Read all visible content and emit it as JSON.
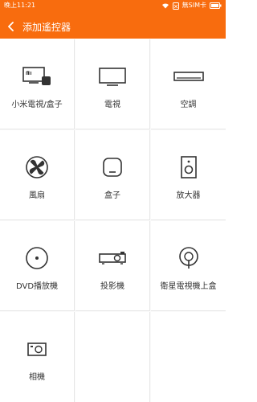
{
  "status_bar": {
    "time": "晚上11:21",
    "sim": "無SIM卡"
  },
  "header": {
    "title": "添加遙控器"
  },
  "devices": [
    {
      "label": "小米電視/盒子",
      "icon": "mi-tv-box-icon"
    },
    {
      "label": "電視",
      "icon": "tv-icon"
    },
    {
      "label": "空調",
      "icon": "air-conditioner-icon"
    },
    {
      "label": "風扇",
      "icon": "fan-icon"
    },
    {
      "label": "盒子",
      "icon": "box-icon"
    },
    {
      "label": "放大器",
      "icon": "speaker-icon"
    },
    {
      "label": "DVD播放機",
      "icon": "dvd-icon"
    },
    {
      "label": "投影機",
      "icon": "projector-icon"
    },
    {
      "label": "衛星電視機上盒",
      "icon": "satellite-icon"
    },
    {
      "label": "相機",
      "icon": "camera-icon"
    }
  ],
  "colors": {
    "accent": "#f86c0e",
    "icon_stroke": "#333333"
  }
}
